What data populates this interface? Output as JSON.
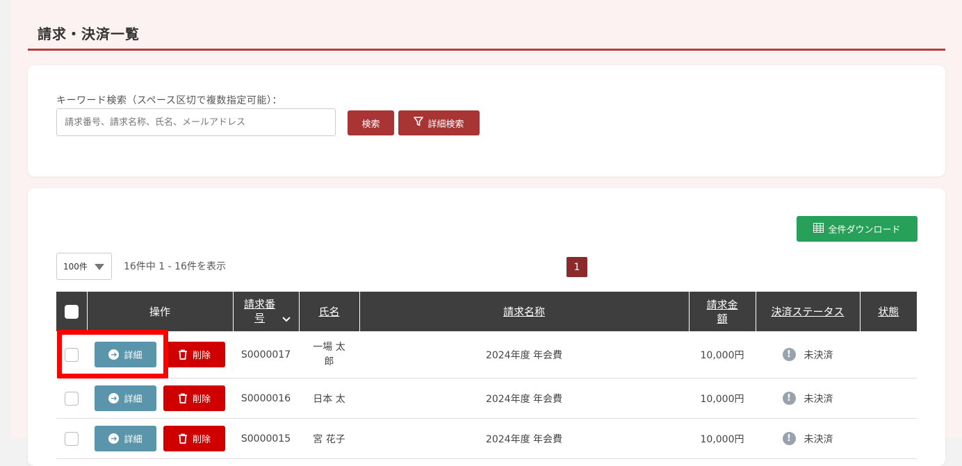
{
  "page": {
    "title": "請求・決済一覧"
  },
  "search": {
    "label": "キーワード検索（スペース区切で複数指定可能）：",
    "placeholder": "請求番号、請求名称、氏名、メールアドレス",
    "value": "",
    "search_button": "検索",
    "advanced_button": "詳細検索"
  },
  "list": {
    "download_button": "全件ダウンロード",
    "per_page": "100件",
    "count_text": "16件中 1 - 16件を表示",
    "current_page": "1",
    "headers": {
      "operation": "操作",
      "invoice_number": "請求番号",
      "name": "氏名",
      "invoice_title": "請求名称",
      "amount": "請求金額",
      "payment_status": "決済ステータス",
      "state": "状態"
    },
    "detail_label": "詳細",
    "delete_label": "削除",
    "rows": [
      {
        "invoice_number": "S0000017",
        "name": "一場 太郎",
        "title": "2024年度 年会費",
        "amount": "10,000円",
        "status": "未決済",
        "state": ""
      },
      {
        "invoice_number": "S0000016",
        "name": "日本 太",
        "title": "2024年度 年会費",
        "amount": "10,000円",
        "status": "未決済",
        "state": ""
      },
      {
        "invoice_number": "S0000015",
        "name": "宮 花子",
        "title": "2024年度 年会費",
        "amount": "10,000円",
        "status": "未決済",
        "state": ""
      }
    ]
  },
  "colors": {
    "accent": "#a83434",
    "header": "#3e3e3e",
    "detail": "#5a95ab",
    "delete": "#d10000",
    "download": "#27a05a",
    "highlight": "#ff0000"
  }
}
